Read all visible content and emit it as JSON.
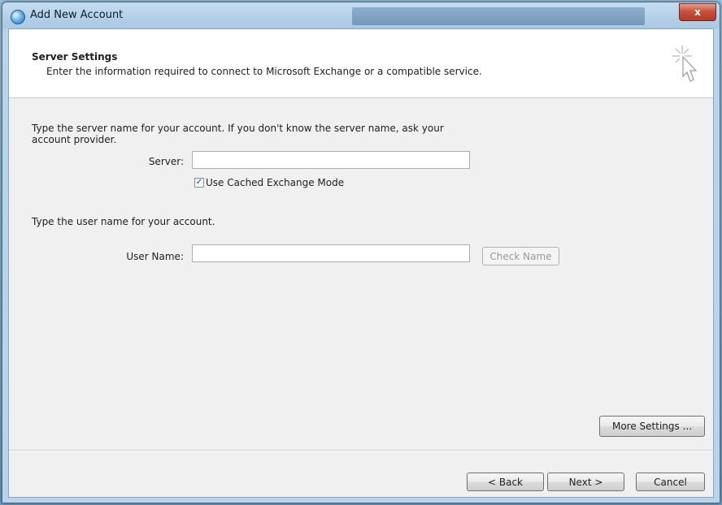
{
  "window": {
    "title": "Add New Account",
    "close_label": "x"
  },
  "header": {
    "title": "Server Settings",
    "subtitle": "Enter the information required to connect to Microsoft Exchange or a compatible service."
  },
  "server_section": {
    "instruction_line1": "Type the server name for your account. If you don't know the server name, ask your",
    "instruction_line2": "account provider.",
    "server_label": "Server:",
    "server_value": "",
    "cached_mode_label": "Use Cached Exchange Mode",
    "cached_mode_checked": true,
    "checkmark": "✓"
  },
  "user_section": {
    "instruction": "Type the user name for your account.",
    "username_label": "User Name:",
    "username_value": "",
    "check_name_label": "Check Name"
  },
  "buttons": {
    "more_settings": "More Settings ...",
    "back": "< Back",
    "next": "Next >",
    "cancel": "Cancel"
  },
  "icons": {
    "app": "globe-mail-icon",
    "wizard": "cursor-sparkle-icon"
  }
}
